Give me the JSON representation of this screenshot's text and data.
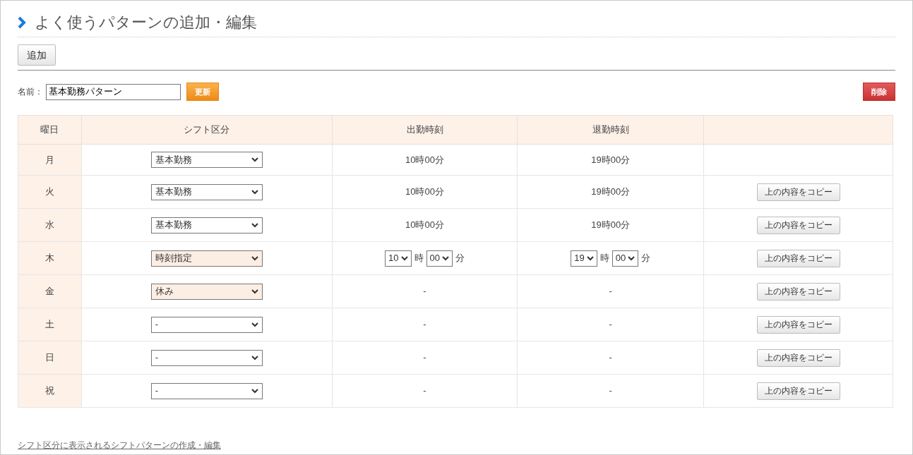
{
  "title": "よく使うパターンの追加・編集",
  "add_button": "追加",
  "name_label": "名前：",
  "name_field": {
    "value": "基本勤務パターン"
  },
  "update_button": "更新",
  "delete_button": "削除",
  "table": {
    "columns": [
      "曜日",
      "シフト区分",
      "出勤時刻",
      "退勤時刻"
    ],
    "rows": [
      {
        "day": "月",
        "shift": "基本勤務",
        "highlighted": false,
        "kind": "fixed",
        "start": "10時00分",
        "end": "19時00分"
      },
      {
        "day": "火",
        "shift": "基本勤務",
        "highlighted": false,
        "kind": "fixed",
        "start": "10時00分",
        "end": "19時00分",
        "copy_button": "上の内容をコピー"
      },
      {
        "day": "水",
        "shift": "基本勤務",
        "highlighted": false,
        "kind": "fixed",
        "start": "10時00分",
        "end": "19時00分",
        "copy_button": "上の内容をコピー"
      },
      {
        "day": "木",
        "shift": "時刻指定",
        "highlighted": true,
        "kind": "select",
        "start": {
          "hour": "10",
          "hour_unit": "時",
          "minute": "00",
          "minute_unit": "分"
        },
        "end": {
          "hour": "19",
          "hour_unit": "時",
          "minute": "00",
          "minute_unit": "分"
        },
        "copy_button": "上の内容をコピー"
      },
      {
        "day": "金",
        "shift": "休み",
        "highlighted": true,
        "kind": "fixed",
        "start": "-",
        "end": "-",
        "copy_button": "上の内容をコピー"
      },
      {
        "day": "土",
        "shift": "-",
        "highlighted": false,
        "kind": "fixed",
        "start": "-",
        "end": "-",
        "copy_button": "上の内容をコピー"
      },
      {
        "day": "日",
        "shift": "-",
        "highlighted": false,
        "kind": "fixed",
        "start": "-",
        "end": "-",
        "copy_button": "上の内容をコピー"
      },
      {
        "day": "祝",
        "shift": "-",
        "highlighted": false,
        "kind": "fixed",
        "start": "-",
        "end": "-",
        "copy_button": "上の内容をコピー"
      }
    ]
  },
  "footer_link": "シフト区分に表示されるシフトパターンの作成・編集"
}
